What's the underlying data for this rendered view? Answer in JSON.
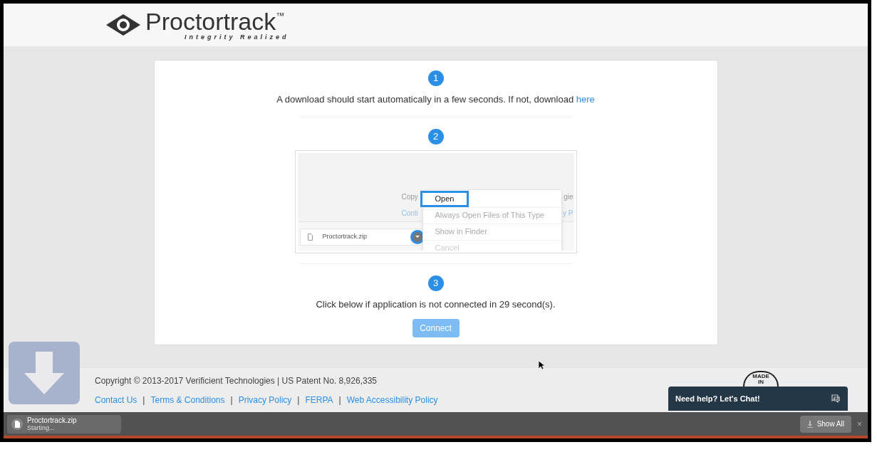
{
  "header": {
    "brand": "Proctortrack",
    "trademark": "™",
    "tagline": "Integrity Realized"
  },
  "steps": [
    {
      "number": "1",
      "kind": "text",
      "text": "A download should start automatically in a few seconds. If not, download ",
      "link": "here"
    },
    {
      "number": "2",
      "kind": "screenshot",
      "shot": {
        "behind_texts": [
          "Copy",
          "gie",
          "Conti",
          "y P"
        ],
        "file": "Proctortrack.zip",
        "menu": [
          {
            "label": "Open",
            "selected": true,
            "disabled": false
          },
          {
            "label": "Always Open Files of This Type",
            "selected": false,
            "disabled": false
          },
          {
            "label": "Show in Finder",
            "selected": false,
            "disabled": false
          },
          {
            "label": "Cancel",
            "selected": false,
            "disabled": true
          }
        ]
      }
    },
    {
      "number": "3",
      "kind": "connect",
      "text": "Click below if application is not connected in 29 second(s).",
      "button": "Connect",
      "disabled": true
    }
  ],
  "footer": {
    "copyright": "Copyright © 2013-2017 Verificient Technologies | US Patent No. 8,926,335",
    "links": [
      "Contact Us",
      "Terms & Conditions",
      "Privacy Policy",
      "FERPA",
      "Web Accessibility Policy"
    ],
    "separator": "|",
    "badge": [
      "MADE",
      "IN"
    ]
  },
  "chat": {
    "label": "Need help? Let's Chat!"
  },
  "download_bar": {
    "file": "Proctortrack.zip",
    "status": "Starting...",
    "show_all": "Show All",
    "close": "×"
  }
}
